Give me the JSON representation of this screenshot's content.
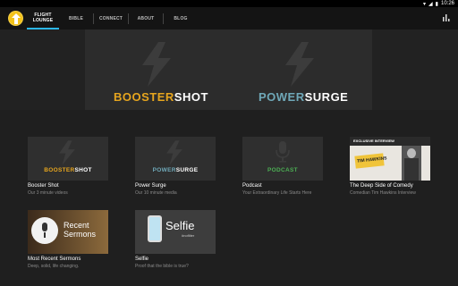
{
  "status_bar": {
    "time": "10:26"
  },
  "nav": {
    "items": [
      {
        "label_line1": "FLIGHT",
        "label_line2": "LOUNGE"
      },
      {
        "label": "BIBLE"
      },
      {
        "label": "CONNECT"
      },
      {
        "label": "ABOUT"
      },
      {
        "label": "BLOG"
      }
    ]
  },
  "hero": {
    "left": {
      "part1": "BOOSTER",
      "part2": "SHOT"
    },
    "right": {
      "part1": "POWER",
      "part2": "SURGE"
    }
  },
  "tiles": [
    {
      "brand_a": "BOOSTER",
      "brand_b": "SHOT",
      "title": "Booster Shot",
      "subtitle": "Our 3 minute videos"
    },
    {
      "brand_a": "POWER",
      "brand_b": "SURGE",
      "title": "Power Surge",
      "subtitle": "Our 10 minute media"
    },
    {
      "brand_a": "PODCAST",
      "title": "Podcast",
      "subtitle": "Your Extraordinary Life Starts Here"
    },
    {
      "thumb_text_top": "EXCLUSIVE INTERVIEW",
      "thumb_text_mid": "TIM HAWKINS",
      "title": "The Deep Side of Comedy",
      "subtitle": "Comedian Tim Hawkins Interview"
    },
    {
      "thumb_text_a": "Recent",
      "thumb_text_b": "Sermons",
      "title": "Most Recent Sermons",
      "subtitle": "Deep, solid, life changing."
    },
    {
      "thumb_text_a": "Selfie",
      "thumb_text_b": "#nofilter",
      "title": "Selfie",
      "subtitle": "Proof that the bible is true?"
    }
  ],
  "colors": {
    "booster": "#e6a51e",
    "power": "#6fa8b8",
    "podcast": "#4cae54",
    "accent": "#2bb6e6"
  }
}
